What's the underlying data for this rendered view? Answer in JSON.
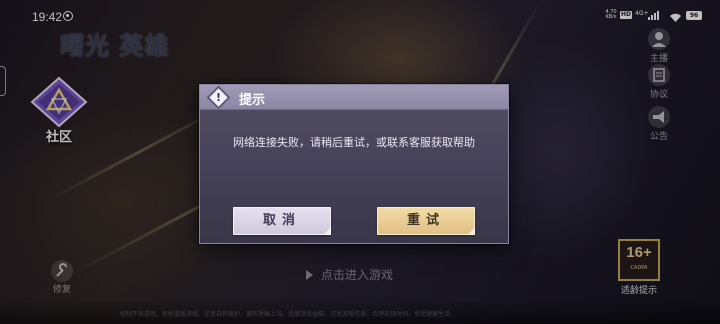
{
  "status_bar": {
    "time": "19:42",
    "network_speed_value": "4.70",
    "network_speed_unit": "KB/s",
    "hd_badge": "HD",
    "network_type": "4G+",
    "battery": "96"
  },
  "game": {
    "logo_text": "曙光 英雄",
    "community_label": "社区",
    "side_icons": [
      {
        "icon": "person-icon",
        "label": "主播"
      },
      {
        "icon": "document-icon",
        "label": "协议"
      },
      {
        "icon": "megaphone-icon",
        "label": "公告"
      }
    ],
    "repair_label": "修复",
    "enter_game": "点击进入游戏",
    "age_rating": "16+",
    "age_rating_sub": "CADPA",
    "age_tip": "适龄提示",
    "footer": "抵制不良游戏，拒绝盗版游戏。注意自我保护，谨防受骗上当。适度游戏益脑，沉迷游戏伤身。合理安排时间，享受健康生活。"
  },
  "dialog": {
    "title": "提示",
    "message": "网络连接失败，请稍后重试，或联系客服获取帮助",
    "cancel_label": "取消",
    "retry_label": "重试",
    "colors": {
      "panel": "#47435a",
      "header": "#9a95b0",
      "cancel_bg": "#dcd6e8",
      "retry_bg": "#ead092"
    }
  }
}
